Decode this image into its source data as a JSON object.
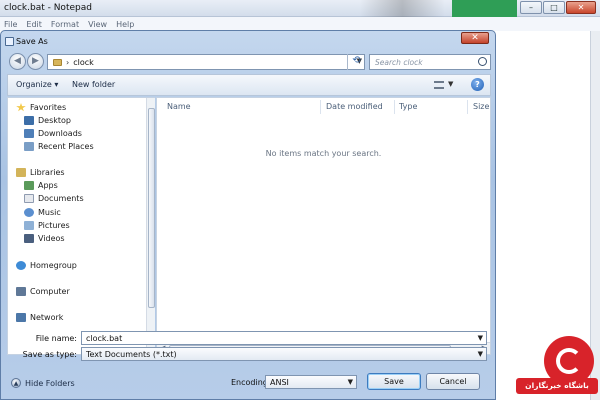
{
  "notepad": {
    "title": "clock.bat - Notepad",
    "menu": [
      "File",
      "Edit",
      "Format",
      "View",
      "Help"
    ],
    "controls": {
      "minimize": "–",
      "maximize": "□",
      "close": "✕"
    }
  },
  "dialog": {
    "title": "Save As",
    "close": "✕",
    "address": {
      "breadcrumb": [
        "clock"
      ],
      "separator": "›"
    },
    "search": {
      "placeholder": "Search clock"
    },
    "toolbar": {
      "organize": "Organize ▾",
      "new_folder": "New folder",
      "help": "?"
    },
    "nav_pane": {
      "favorites": {
        "label": "Favorites",
        "items": [
          "Desktop",
          "Downloads",
          "Recent Places"
        ]
      },
      "libraries": {
        "label": "Libraries",
        "items": [
          "Apps",
          "Documents",
          "Music",
          "Pictures",
          "Videos"
        ]
      },
      "homegroup": "Homegroup",
      "computer": "Computer",
      "network": "Network"
    },
    "file_list": {
      "columns": [
        "Name",
        "Date modified",
        "Type",
        "Size"
      ],
      "empty_message": "No items match your search."
    },
    "file_name": {
      "label": "File name:",
      "value": "clock.bat"
    },
    "save_as_type": {
      "label": "Save as type:",
      "value": "Text Documents (*.txt)"
    },
    "hide_folders": "Hide Folders",
    "encoding": {
      "label": "Encoding:",
      "value": "ANSI"
    },
    "buttons": {
      "save": "Save",
      "cancel": "Cancel"
    }
  },
  "watermark": {
    "text": "باشگاه خبرنگاران"
  },
  "colors": {
    "accent": "#3d7bbf",
    "close_red": "#c4432b",
    "watermark_red": "#d8232a"
  }
}
